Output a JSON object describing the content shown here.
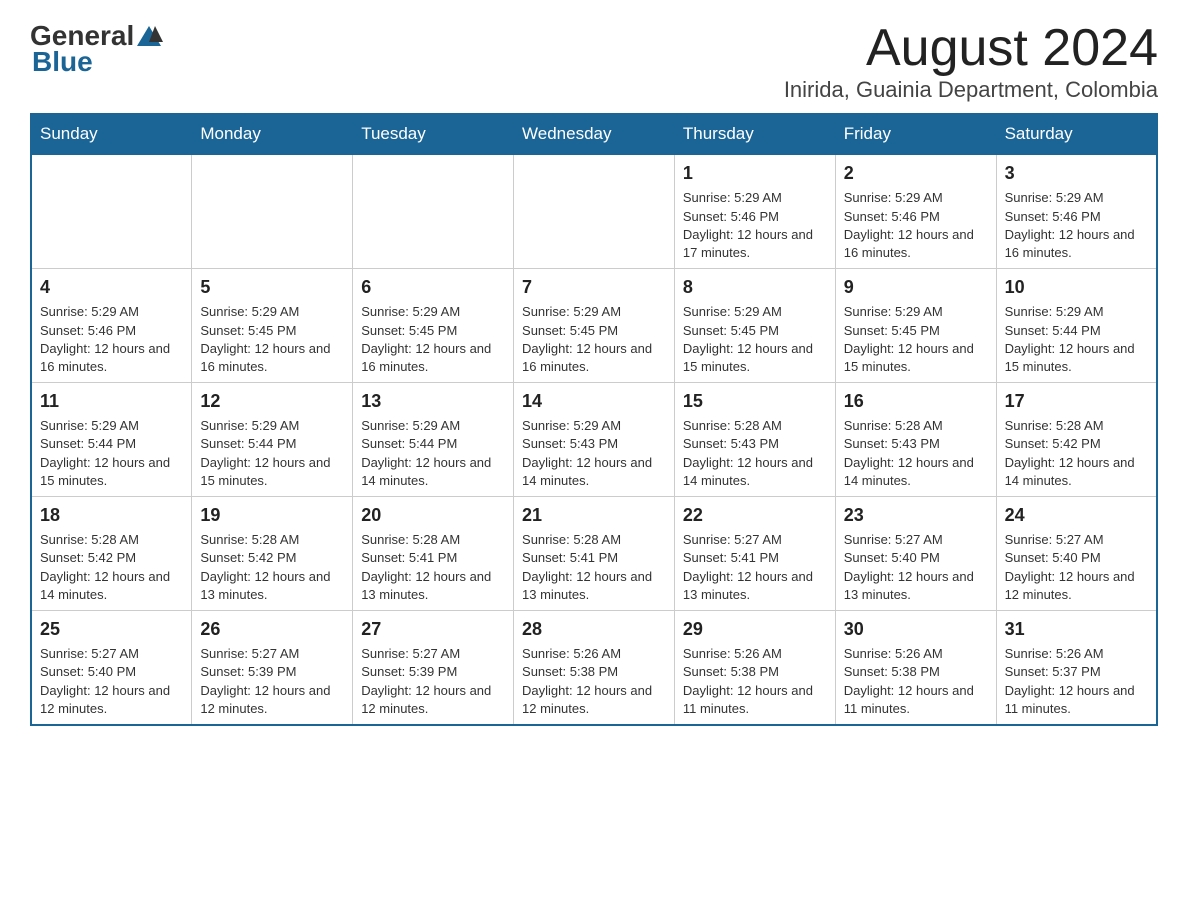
{
  "header": {
    "logo_general": "General",
    "logo_blue": "Blue",
    "month_title": "August 2024",
    "location": "Inirida, Guainia Department, Colombia"
  },
  "days_of_week": [
    "Sunday",
    "Monday",
    "Tuesday",
    "Wednesday",
    "Thursday",
    "Friday",
    "Saturday"
  ],
  "weeks": [
    [
      {
        "day": "",
        "info": ""
      },
      {
        "day": "",
        "info": ""
      },
      {
        "day": "",
        "info": ""
      },
      {
        "day": "",
        "info": ""
      },
      {
        "day": "1",
        "info": "Sunrise: 5:29 AM\nSunset: 5:46 PM\nDaylight: 12 hours and 17 minutes."
      },
      {
        "day": "2",
        "info": "Sunrise: 5:29 AM\nSunset: 5:46 PM\nDaylight: 12 hours and 16 minutes."
      },
      {
        "day": "3",
        "info": "Sunrise: 5:29 AM\nSunset: 5:46 PM\nDaylight: 12 hours and 16 minutes."
      }
    ],
    [
      {
        "day": "4",
        "info": "Sunrise: 5:29 AM\nSunset: 5:46 PM\nDaylight: 12 hours and 16 minutes."
      },
      {
        "day": "5",
        "info": "Sunrise: 5:29 AM\nSunset: 5:45 PM\nDaylight: 12 hours and 16 minutes."
      },
      {
        "day": "6",
        "info": "Sunrise: 5:29 AM\nSunset: 5:45 PM\nDaylight: 12 hours and 16 minutes."
      },
      {
        "day": "7",
        "info": "Sunrise: 5:29 AM\nSunset: 5:45 PM\nDaylight: 12 hours and 16 minutes."
      },
      {
        "day": "8",
        "info": "Sunrise: 5:29 AM\nSunset: 5:45 PM\nDaylight: 12 hours and 15 minutes."
      },
      {
        "day": "9",
        "info": "Sunrise: 5:29 AM\nSunset: 5:45 PM\nDaylight: 12 hours and 15 minutes."
      },
      {
        "day": "10",
        "info": "Sunrise: 5:29 AM\nSunset: 5:44 PM\nDaylight: 12 hours and 15 minutes."
      }
    ],
    [
      {
        "day": "11",
        "info": "Sunrise: 5:29 AM\nSunset: 5:44 PM\nDaylight: 12 hours and 15 minutes."
      },
      {
        "day": "12",
        "info": "Sunrise: 5:29 AM\nSunset: 5:44 PM\nDaylight: 12 hours and 15 minutes."
      },
      {
        "day": "13",
        "info": "Sunrise: 5:29 AM\nSunset: 5:44 PM\nDaylight: 12 hours and 14 minutes."
      },
      {
        "day": "14",
        "info": "Sunrise: 5:29 AM\nSunset: 5:43 PM\nDaylight: 12 hours and 14 minutes."
      },
      {
        "day": "15",
        "info": "Sunrise: 5:28 AM\nSunset: 5:43 PM\nDaylight: 12 hours and 14 minutes."
      },
      {
        "day": "16",
        "info": "Sunrise: 5:28 AM\nSunset: 5:43 PM\nDaylight: 12 hours and 14 minutes."
      },
      {
        "day": "17",
        "info": "Sunrise: 5:28 AM\nSunset: 5:42 PM\nDaylight: 12 hours and 14 minutes."
      }
    ],
    [
      {
        "day": "18",
        "info": "Sunrise: 5:28 AM\nSunset: 5:42 PM\nDaylight: 12 hours and 14 minutes."
      },
      {
        "day": "19",
        "info": "Sunrise: 5:28 AM\nSunset: 5:42 PM\nDaylight: 12 hours and 13 minutes."
      },
      {
        "day": "20",
        "info": "Sunrise: 5:28 AM\nSunset: 5:41 PM\nDaylight: 12 hours and 13 minutes."
      },
      {
        "day": "21",
        "info": "Sunrise: 5:28 AM\nSunset: 5:41 PM\nDaylight: 12 hours and 13 minutes."
      },
      {
        "day": "22",
        "info": "Sunrise: 5:27 AM\nSunset: 5:41 PM\nDaylight: 12 hours and 13 minutes."
      },
      {
        "day": "23",
        "info": "Sunrise: 5:27 AM\nSunset: 5:40 PM\nDaylight: 12 hours and 13 minutes."
      },
      {
        "day": "24",
        "info": "Sunrise: 5:27 AM\nSunset: 5:40 PM\nDaylight: 12 hours and 12 minutes."
      }
    ],
    [
      {
        "day": "25",
        "info": "Sunrise: 5:27 AM\nSunset: 5:40 PM\nDaylight: 12 hours and 12 minutes."
      },
      {
        "day": "26",
        "info": "Sunrise: 5:27 AM\nSunset: 5:39 PM\nDaylight: 12 hours and 12 minutes."
      },
      {
        "day": "27",
        "info": "Sunrise: 5:27 AM\nSunset: 5:39 PM\nDaylight: 12 hours and 12 minutes."
      },
      {
        "day": "28",
        "info": "Sunrise: 5:26 AM\nSunset: 5:38 PM\nDaylight: 12 hours and 12 minutes."
      },
      {
        "day": "29",
        "info": "Sunrise: 5:26 AM\nSunset: 5:38 PM\nDaylight: 12 hours and 11 minutes."
      },
      {
        "day": "30",
        "info": "Sunrise: 5:26 AM\nSunset: 5:38 PM\nDaylight: 12 hours and 11 minutes."
      },
      {
        "day": "31",
        "info": "Sunrise: 5:26 AM\nSunset: 5:37 PM\nDaylight: 12 hours and 11 minutes."
      }
    ]
  ]
}
